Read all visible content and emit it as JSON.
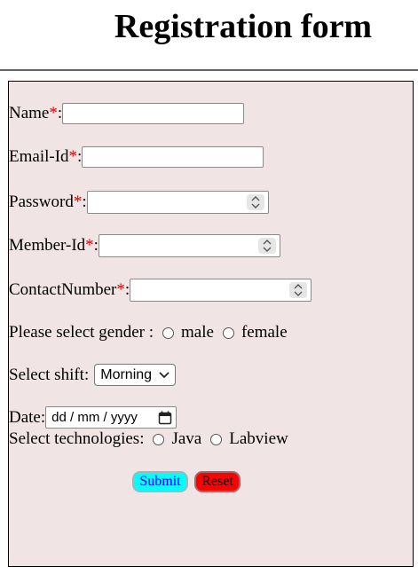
{
  "page": {
    "title": "Registration form"
  },
  "form": {
    "name_label": "Name",
    "email_label": "Email-Id",
    "password_label": "Password",
    "member_label": "Member-Id",
    "contact_label": "ContactNumber",
    "required_mark": "*",
    "colon": ":",
    "gender_label": "Please select gender :",
    "gender_options": [
      "male",
      "female"
    ],
    "shift_label": "Select shift:",
    "shift_selected": "Morning",
    "date_label": "Date:",
    "date_placeholder": "dd / mm / yyyy",
    "tech_label": "Select technologies:",
    "tech_options": [
      "Java",
      "Labview"
    ],
    "submit_label": "Submit",
    "reset_label": "Reset"
  },
  "colors": {
    "form_background": "#f0e4e4",
    "required": "#e00000",
    "submit_bg": "#00ffff",
    "submit_text": "#0000ff",
    "reset_bg": "#ff0000"
  },
  "icons": [
    "calendar-icon",
    "chevron-down-icon",
    "spinner-icon"
  ]
}
